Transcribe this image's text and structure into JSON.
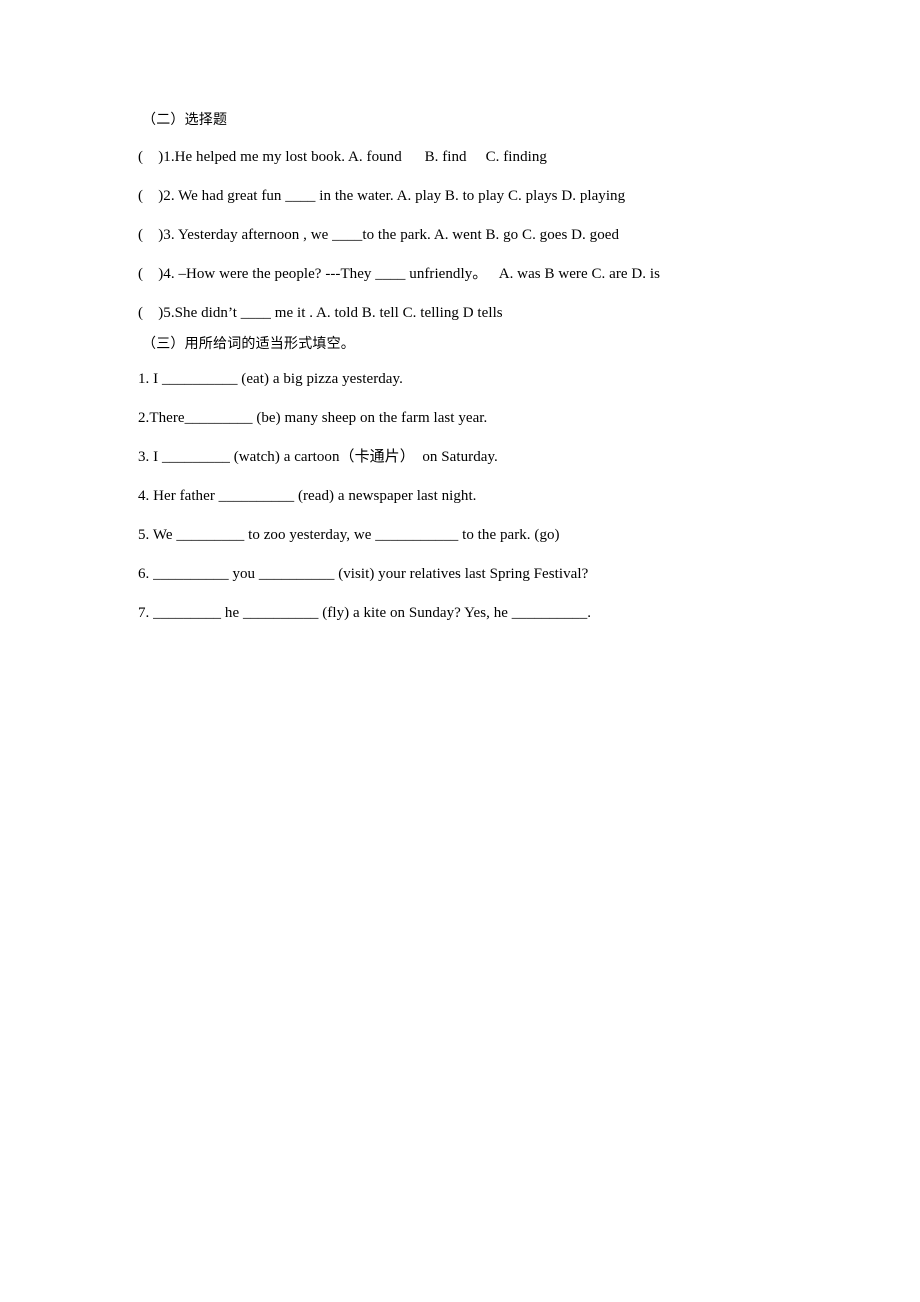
{
  "document": {
    "sections": [
      {
        "id": "section-two",
        "heading": "（二）选择题",
        "type": "multiple-choice",
        "items": [
          "(    )1.He helped me my lost book. A. found      B. find     C. finding",
          "(    )2. We had great fun ____ in the water. A. play B. to play C. plays D. playing",
          "(    )3. Yesterday afternoon , we ____to the park. A. went B. go C. goes D. goed",
          "(    )4. –How were the people? ---They ____ unfriendly。   A. was B were C. are D. is",
          "(    )5.She didn’t ____ me it . A. told B. tell C. telling D tells"
        ]
      },
      {
        "id": "section-three",
        "heading": "（三）用所给词的适当形式填空。",
        "type": "fill-in-the-blank",
        "items": [
          "1. I __________ (eat) a big pizza yesterday.",
          "2.There_________ (be) many sheep on the farm last year.",
          "3. I _________ (watch) a cartoon（卡通片）  on Saturday.",
          "4. Her father __________ (read) a newspaper last night.",
          "5. We _________ to zoo yesterday, we ___________ to the park. (go)",
          "6. __________ you __________ (visit) your relatives last Spring Festival?",
          "7. _________ he __________ (fly) a kite on Sunday? Yes, he __________."
        ]
      }
    ]
  }
}
